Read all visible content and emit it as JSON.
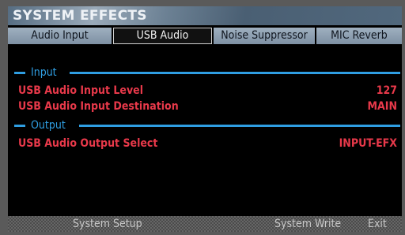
{
  "window": {
    "title": "SYSTEM EFFECTS"
  },
  "tabs": [
    {
      "label": "Audio Input"
    },
    {
      "label": "USB Audio",
      "active": true
    },
    {
      "label": "Noise Suppressor"
    },
    {
      "label": "MIC Reverb"
    }
  ],
  "sections": {
    "input": {
      "label": "Input"
    },
    "output": {
      "label": "Output"
    }
  },
  "params": {
    "input_level": {
      "label": "USB Audio Input Level",
      "value": "127"
    },
    "input_destination": {
      "label": "USB Audio Input Destination",
      "value": "MAIN"
    },
    "output_select": {
      "label": "USB Audio Output Select",
      "value": "INPUT-EFX"
    }
  },
  "footer": {
    "system_setup": "System Setup",
    "system_write": "System Write",
    "exit": "Exit"
  },
  "colors": {
    "section_accent": "#2f9ee2",
    "param_text": "#e8394a",
    "tab_bg": "#8fa1b3",
    "title_bar": "#5f768b"
  }
}
